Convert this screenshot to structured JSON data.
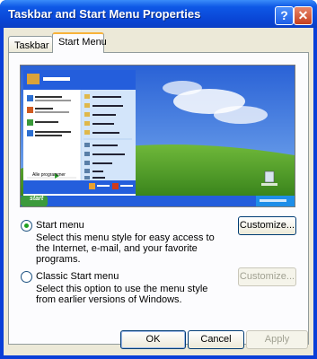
{
  "window": {
    "title": "Taskbar and Start Menu Properties",
    "help_label": "?",
    "close_label": "✕"
  },
  "tabs": [
    {
      "label": "Taskbar"
    },
    {
      "label": "Start Menu"
    }
  ],
  "preview": {
    "start_label": "start",
    "all_programs_label": "Alle programmer"
  },
  "start_menu_option": {
    "label": "Start menu",
    "description": "Select this menu style for easy access to the Internet, e-mail, and your favorite programs.",
    "customize_label": "Customize..."
  },
  "classic_option": {
    "label": "Classic Start menu",
    "description": "Select this option to use the menu style from earlier versions of Windows.",
    "customize_label": "Customize..."
  },
  "buttons": {
    "ok": "OK",
    "cancel": "Cancel",
    "apply": "Apply"
  },
  "colors": {
    "titlebar": "#0a46d6",
    "client": "#ece9d8",
    "tab_highlight": "#f8b33a",
    "radio_dot": "#21a121"
  }
}
